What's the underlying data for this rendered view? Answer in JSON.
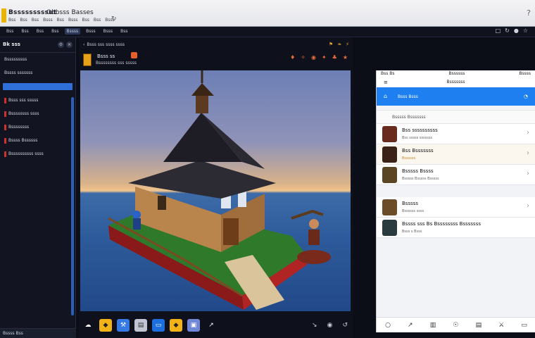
{
  "topbar": {
    "title": "Bsssssssssut",
    "subtitle": "Obbsss Basses",
    "menu": [
      "Bss",
      "Bss",
      "Bss",
      "Bsss",
      "Bss",
      "Bsss",
      "Bss",
      "Bss",
      "Bsss"
    ],
    "hint_icon": "?"
  },
  "strip": {
    "crumbs": [
      "Bss",
      "Bss",
      "Bss",
      "Bss",
      "Bssss",
      "Bsss",
      "Bsss",
      "Bss"
    ],
    "right_icons": [
      "□",
      "↻",
      "●",
      "☆"
    ]
  },
  "sidebar": {
    "header": "Bk sss",
    "items": [
      {
        "label": "Bsssssssss",
        "active": false
      },
      {
        "label": "Bssss sssssss",
        "active": false
      },
      {
        "label": "",
        "active": true
      },
      {
        "label": "Bsss sss sssss",
        "active": false
      },
      {
        "label": "Bssssssss ssss",
        "active": false
      },
      {
        "label": "Bssssssss",
        "active": false
      },
      {
        "label": "Bssss Bssssss",
        "active": false
      },
      {
        "label": "Bssssssssss ssss",
        "active": false
      }
    ],
    "footer": "Bssss  Bss"
  },
  "editor": {
    "head_label": "Bsss sss ssss ssss",
    "file_name": "Bsss ss",
    "file_path": "Bssssssss sss sssss",
    "tools": [
      "♦",
      "✧",
      "◉",
      "✦",
      "♣",
      "★"
    ],
    "bottom_tools": [
      {
        "icon": "☁",
        "color": "#0e111b"
      },
      {
        "icon": "◆",
        "color": "#f3b318"
      },
      {
        "icon": "⚒",
        "color": "#3579e3"
      },
      {
        "icon": "▤",
        "color": "#c1c5d3"
      },
      {
        "icon": "▭",
        "color": "#1c6fdc"
      },
      {
        "icon": "◆",
        "color": "#f3b318"
      },
      {
        "icon": "▣",
        "color": "#6f87d6"
      },
      {
        "icon": "↗",
        "color": "#0e111b"
      }
    ],
    "bottom_right": [
      "↘",
      "◉",
      "↺"
    ]
  },
  "rpanel": {
    "status_left": "Bss Bs",
    "status_mid": "Bssssss",
    "status_right": "Bssss",
    "title": "Bsssssss",
    "bar_label": "Bsss Bsss",
    "section": "Bsssss Bsssssss",
    "items": [
      {
        "title": "Bss ssssssssss",
        "sub": "Bss sssss sssssss",
        "color": "#6b2a1e",
        "hl": false
      },
      {
        "title": "Bss Bsssssss",
        "sub": "Bssssss",
        "color": "#3b2216",
        "hl": true
      },
      {
        "title": "Bsssss Bssss",
        "sub": "Bsssss Bsssss Bsssss",
        "color": "#5a4622",
        "hl": false
      },
      {
        "title": "Bsssss",
        "sub": "Bssssss ssss",
        "color": "#6c4d2a",
        "hl": false
      },
      {
        "title": "Bssss sss Bs Bssssssss Bsssssss",
        "sub": "Bsss s Bsss",
        "color": "#2a3b3f",
        "hl": false
      }
    ],
    "nav_icons": [
      "○",
      "↗",
      "▥",
      "☉",
      "▤",
      "⚔",
      "▭"
    ]
  }
}
